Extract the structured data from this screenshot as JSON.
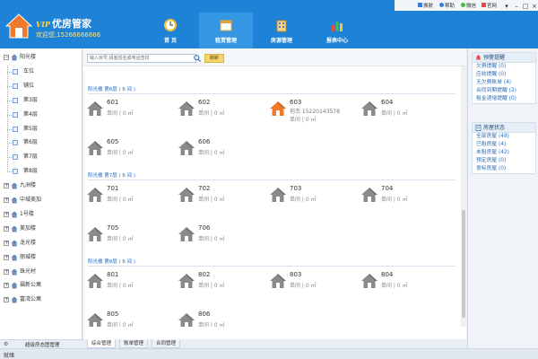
{
  "app": {
    "vip_badge": "VIP",
    "title": "优房管家",
    "welcome": "欢迎您,15266666666"
  },
  "top_links": {
    "skin": "换肤",
    "help": "帮助",
    "wechat": "微信",
    "website": "官网"
  },
  "nav": [
    {
      "label": "首 页",
      "icon": "clock-icon"
    },
    {
      "label": "租赁管理",
      "icon": "calendar-icon"
    },
    {
      "label": "房源管理",
      "icon": "building-icon"
    },
    {
      "label": "报表中心",
      "icon": "bar-chart-icon"
    }
  ],
  "tree": {
    "buildings_before": [
      "阳光楼"
    ],
    "floors": [
      "车位",
      "铺位",
      "第3层",
      "第4层",
      "第5层",
      "第6层",
      "第7层",
      "第8层"
    ],
    "buildings_after": [
      "九洲楼",
      "中城美加",
      "1号楼",
      "美加楼",
      "龙光楼",
      "丽城楼",
      "珠光村",
      "福新公寓",
      "富湾公寓"
    ],
    "bottom_label": "超级房态图管理"
  },
  "toolbar": {
    "search_placeholder": "输入房号,租客姓名或电话查找",
    "refresh_label": "刷新"
  },
  "floors": [
    {
      "title": "阳光楼 第6层 ( 6 间 )",
      "rooms": [
        {
          "num": "601",
          "status": "vacant",
          "tenant": "",
          "price": "单间 | 0 ㎡"
        },
        {
          "num": "602",
          "status": "vacant",
          "tenant": "",
          "price": "单间 | 0 ㎡"
        },
        {
          "num": "603",
          "status": "occupied",
          "tenant": "何杰 15220143578",
          "price": "单间 | 0 ㎡"
        },
        {
          "num": "604",
          "status": "vacant",
          "tenant": "",
          "price": "单间 | 0 ㎡"
        },
        {
          "num": "605",
          "status": "vacant",
          "tenant": "",
          "price": "单间 | 0 ㎡"
        },
        {
          "num": "606",
          "status": "vacant",
          "tenant": "",
          "price": "单间 | 0 ㎡"
        }
      ]
    },
    {
      "title": "阳光楼 第7层 ( 6 间 )",
      "rooms": [
        {
          "num": "701",
          "status": "vacant",
          "tenant": "",
          "price": "单间 | 0 ㎡"
        },
        {
          "num": "702",
          "status": "vacant",
          "tenant": "",
          "price": "单间 | 0 ㎡"
        },
        {
          "num": "703",
          "status": "vacant",
          "tenant": "",
          "price": "单间 | 0 ㎡"
        },
        {
          "num": "704",
          "status": "vacant",
          "tenant": "",
          "price": "单间 | 0 ㎡"
        },
        {
          "num": "705",
          "status": "vacant",
          "tenant": "",
          "price": "单间 | 0 ㎡"
        },
        {
          "num": "706",
          "status": "vacant",
          "tenant": "",
          "price": "单间 | 0 ㎡"
        }
      ]
    },
    {
      "title": "阳光楼 第8层 ( 6 间 )",
      "rooms": [
        {
          "num": "801",
          "status": "vacant",
          "tenant": "",
          "price": "单间 | 0 ㎡"
        },
        {
          "num": "802",
          "status": "vacant",
          "tenant": "",
          "price": "单间 | 0 ㎡"
        },
        {
          "num": "803",
          "status": "vacant",
          "tenant": "",
          "price": "单间 | 0 ㎡"
        },
        {
          "num": "804",
          "status": "vacant",
          "tenant": "",
          "price": "单间 | 0 ㎡"
        },
        {
          "num": "805",
          "status": "vacant",
          "tenant": "",
          "price": "单间 | 0 ㎡"
        },
        {
          "num": "806",
          "status": "vacant",
          "tenant": "",
          "price": "单间 | 0 ㎡"
        }
      ]
    }
  ],
  "bottom_tabs": [
    "综合管理",
    "账单管理",
    "合同管理"
  ],
  "reminders": {
    "title": "预警提醒",
    "items": [
      "欠费提醒 (0)",
      "应收提醒 (0)",
      "无欠费账单 (4)",
      "合同到期提醒 (2)",
      "租金递增提醒 (0)"
    ]
  },
  "room_status": {
    "title": "房屋状态",
    "items": [
      "全部房屋 (48)",
      "已租房屋 (4)",
      "未租房屋 (42)",
      "预定房屋 (0)",
      "意标房屋 (0)"
    ]
  },
  "status_bar": "就绪",
  "colors": {
    "header_blue": "#1e82d6",
    "vacant_house": "#8a8a8a",
    "occupied_house": "#f07a2a"
  }
}
